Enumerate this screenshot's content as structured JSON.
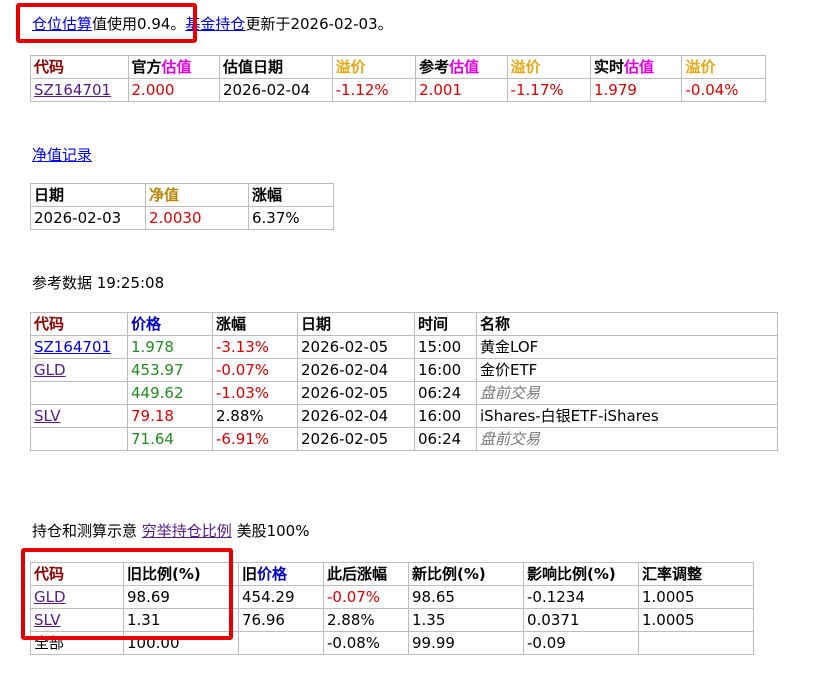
{
  "intro": {
    "link1": "仓位估算",
    "text1": "值使用0.94。",
    "link2": "基金持仓",
    "text2": "更新于2026-02-03。"
  },
  "est_table": {
    "headers": {
      "code": "代码",
      "official_prefix": "官方",
      "official_suffix": "估值",
      "est_date": "估值日期",
      "premium1": "溢价",
      "ref_prefix": "参考",
      "ref_suffix": "估值",
      "premium2": "溢价",
      "rt_prefix": "实时",
      "rt_suffix": "估值",
      "premium3": "溢价"
    },
    "row": {
      "code": "SZ164701",
      "official": "2.000",
      "date": "2026-02-04",
      "premium1": "-1.12%",
      "ref": "2.001",
      "premium2": "-1.17%",
      "rt": "1.979",
      "premium3": "-0.04%"
    }
  },
  "nav_link": "净值记录",
  "nav_table": {
    "headers": {
      "date": "日期",
      "nav": "净值",
      "change": "涨幅"
    },
    "row": {
      "date": "2026-02-03",
      "nav": "2.0030",
      "change": "6.37%"
    }
  },
  "ref_title": "参考数据 19:25:08",
  "ref_table": {
    "headers": {
      "code": "代码",
      "price": "价格",
      "change": "涨幅",
      "date": "日期",
      "time": "时间",
      "name": "名称"
    },
    "rows": [
      {
        "code": "SZ164701",
        "price": "1.978",
        "change": "-3.13%",
        "date": "2026-02-05",
        "time": "15:00",
        "name": "黄金LOF"
      },
      {
        "code": "GLD",
        "price": "453.97",
        "change": "-0.07%",
        "date": "2026-02-04",
        "time": "16:00",
        "name": "金价ETF"
      },
      {
        "code": "",
        "price": "449.62",
        "change": "-1.03%",
        "date": "2026-02-05",
        "time": "06:24",
        "name": "盘前交易"
      },
      {
        "code": "SLV",
        "price": "79.18",
        "change": "2.88%",
        "date": "2026-02-04",
        "time": "16:00",
        "name": "iShares-白银ETF-iShares"
      },
      {
        "code": "",
        "price": "71.64",
        "change": "-6.91%",
        "date": "2026-02-05",
        "time": "06:24",
        "name": "盘前交易"
      }
    ]
  },
  "hold_title": {
    "text1": "持仓和测算示意",
    "link": "穷举持仓比例",
    "text2": "美股100%"
  },
  "hold_table": {
    "headers": {
      "code": "代码",
      "old_ratio": "旧比例(%)",
      "old_price_prefix": "旧",
      "old_price_suffix": "价格",
      "change_after": "此后涨幅",
      "new_ratio": "新比例(%)",
      "impact": "影响比例(%)",
      "fx": "汇率调整"
    },
    "rows": [
      {
        "code": "GLD",
        "old_ratio": "98.69",
        "old_price": "454.29",
        "change_after": "-0.07%",
        "new_ratio": "98.65",
        "impact": "-0.1234",
        "fx": "1.0005"
      },
      {
        "code": "SLV",
        "old_ratio": "1.31",
        "old_price": "76.96",
        "change_after": "2.88%",
        "new_ratio": "1.35",
        "impact": "0.0371",
        "fx": "1.0005"
      }
    ],
    "total": {
      "code": "全部",
      "old_ratio": "100.00",
      "old_price": "",
      "change_after": "-0.08%",
      "new_ratio": "99.99",
      "impact": "-0.09",
      "fx": ""
    }
  },
  "colors": {
    "link": "#0000ee",
    "visited": "#551a8b",
    "header_code": "#8b0000",
    "header_olive": "#b8860b",
    "green": "#228b22",
    "red": "#e00000",
    "gold": "#e6a817",
    "magenta": "#e800e8",
    "highlight": "#e60000"
  }
}
